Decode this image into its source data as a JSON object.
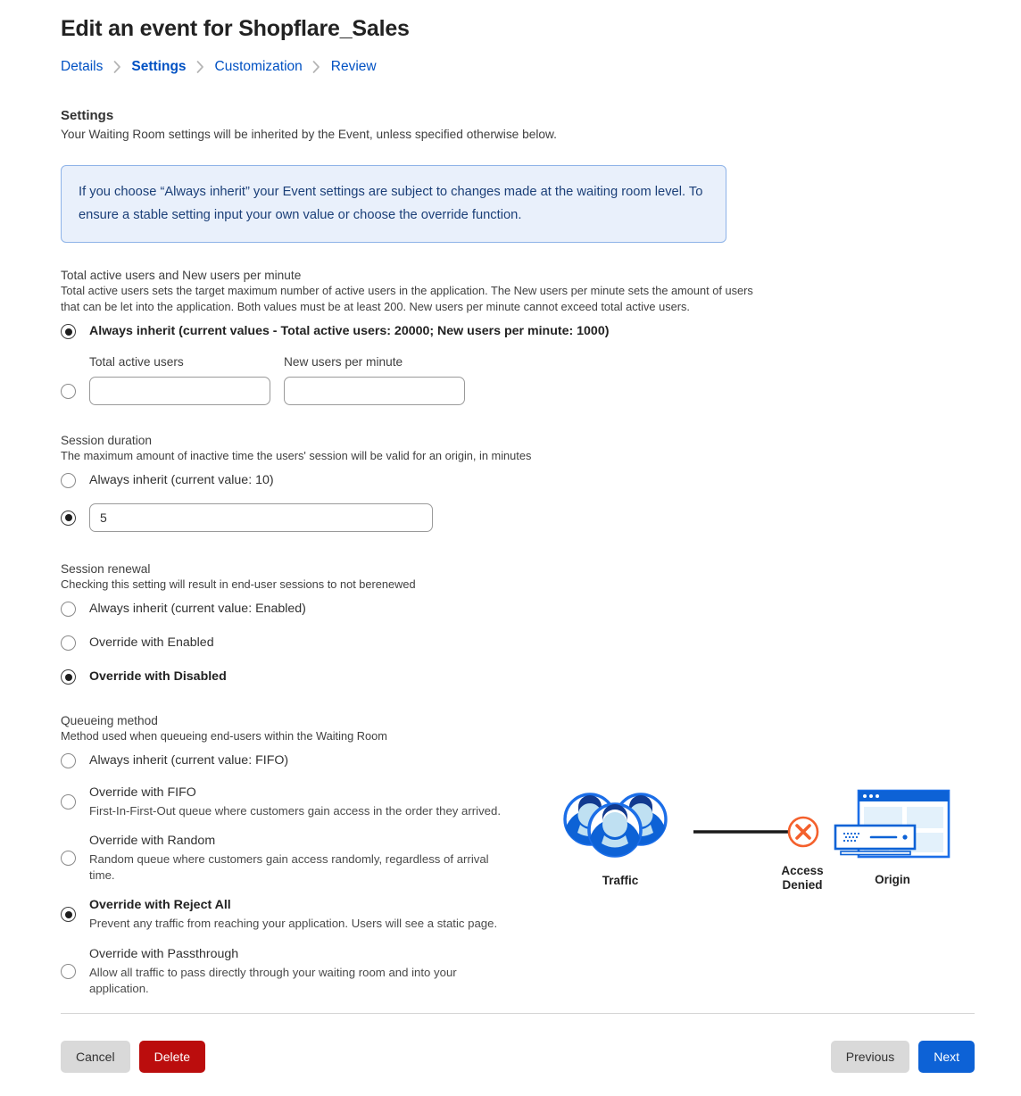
{
  "header": {
    "title": "Edit an event for Shopflare_Sales",
    "breadcrumb": [
      {
        "label": "Details",
        "active": false
      },
      {
        "label": "Settings",
        "active": true
      },
      {
        "label": "Customization",
        "active": false
      },
      {
        "label": "Review",
        "active": false
      }
    ]
  },
  "settings": {
    "heading": "Settings",
    "description": "Your Waiting Room settings will be inherited by the Event, unless specified otherwise below.",
    "banner": "If you choose “Always inherit” your Event settings are subject to changes made at the waiting room level. To ensure a stable setting input your own value or choose the override function."
  },
  "total_active_users": {
    "label": "Total active users and New users per minute",
    "help": "Total active users sets the target maximum number of active users in the application. The New users per minute sets the amount of users that can be let into the application. Both values must be at least 200. New users per minute cannot exceed total active users.",
    "option_inherit": "Always inherit (current values - Total active users: 20000; New users per minute: 1000)",
    "inherit_selected": true,
    "custom_selected": false,
    "fields": [
      {
        "caption": "Total active users",
        "value": "",
        "placeholder": ""
      },
      {
        "caption": "New users per minute",
        "value": "",
        "placeholder": ""
      }
    ]
  },
  "session_duration": {
    "label": "Session duration",
    "help": "The maximum amount of inactive time the users' session will be valid for an origin, in minutes",
    "option_inherit": "Always inherit (current value: 10)",
    "inherit_selected": false,
    "custom_selected": true,
    "value": "5",
    "placeholder": ""
  },
  "session_renewal": {
    "label": "Session renewal",
    "help": "Checking this setting will result in end-user sessions to not berenewed",
    "options": [
      {
        "label": "Always inherit (current value: Enabled)",
        "selected": false
      },
      {
        "label": "Override with Enabled",
        "selected": false
      },
      {
        "label": "Override with Disabled",
        "selected": true
      }
    ]
  },
  "queueing_method": {
    "label": "Queueing method",
    "help": "Method used when queueing end-users within the Waiting Room",
    "options": [
      {
        "label": "Always inherit (current value: FIFO)",
        "sub": "",
        "selected": false
      },
      {
        "label": "Override with FIFO",
        "sub": "First-In-First-Out queue where customers gain access in the order they arrived.",
        "selected": false
      },
      {
        "label": "Override with Random",
        "sub": "Random queue where customers gain access randomly, regardless of arrival time.",
        "selected": false
      },
      {
        "label": "Override with Reject All",
        "sub": "Prevent any traffic from reaching your application. Users will see a static page.",
        "selected": true
      },
      {
        "label": "Override with Passthrough",
        "sub": "Allow all traffic to pass directly through your waiting room and into your application.",
        "selected": false
      }
    ]
  },
  "illustration": {
    "traffic_label": "Traffic",
    "access_label": "Access\nDenied",
    "access_label_line1": "Access",
    "access_label_line2": "Denied",
    "origin_label": "Origin",
    "colors": {
      "blue": "#0d62d6",
      "light_blue": "#cde6f5",
      "dark_blue": "#123a8f",
      "deny_orange": "#f4602c"
    }
  },
  "footer": {
    "cancel": "Cancel",
    "delete": "Delete",
    "previous": "Previous",
    "next": "Next",
    "colors": {
      "delete_red": "#bb0d0d",
      "next_blue": "#0d62d6",
      "grey": "#d9d9d9"
    }
  }
}
